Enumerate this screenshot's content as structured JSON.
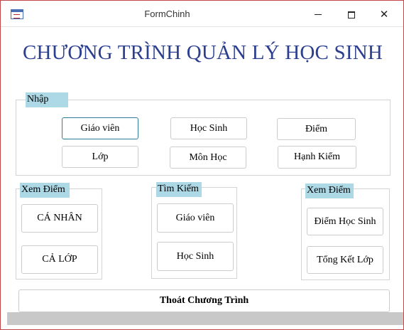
{
  "window": {
    "title": "FormChinh",
    "app_icon": "form-icon",
    "controls": {
      "minimize": "minimize-icon",
      "maximize": "maximize-icon",
      "close": "close-icon",
      "close_glyph": "✕"
    }
  },
  "header": {
    "title": "CHƯƠNG TRÌNH QUẢN LÝ HỌC SINH"
  },
  "groups": {
    "nhap": {
      "label": "Nhập",
      "buttons": [
        "Giáo viên",
        "Học Sinh",
        "Điểm",
        "Lớp",
        "Môn Học",
        "Hạnh Kiểm"
      ]
    },
    "xem_diem_left": {
      "label": "Xem Điểm",
      "buttons": [
        "CÁ NHÂN",
        "CẢ LỚP"
      ]
    },
    "tim_kiem": {
      "label": "Tìm Kiếm",
      "buttons": [
        "Giáo viên",
        "Học Sinh"
      ]
    },
    "xem_diem_right": {
      "label": "Xem Điểm",
      "buttons": [
        "Điểm Học Sinh",
        "Tổng Kết Lớp"
      ]
    }
  },
  "footer": {
    "exit_label": "Thoát Chương Trình"
  },
  "colors": {
    "title": "#2c3f8f",
    "group_label_bg": "#add8e6",
    "window_border": "#c04848"
  }
}
